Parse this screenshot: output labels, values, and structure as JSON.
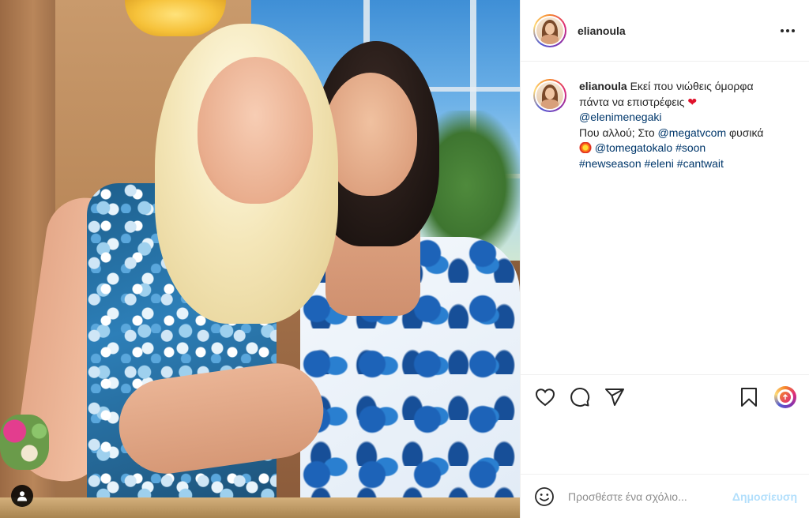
{
  "post": {
    "username": "elianoula",
    "caption": {
      "username": "elianoula",
      "line1": "Εκεί που νιώθεις όμορφα",
      "line2": "πάντα να επιστρέφεις",
      "mention1": "@elenimenegaki",
      "line3_prefix": "Που αλλού; Στο",
      "mention2": "@megatvcom",
      "line3_suffix": "φυσικά",
      "mention3": "@tomegatokalo",
      "hashtag1": "#soon",
      "hashtag2": "#newseason",
      "hashtag3": "#eleni",
      "hashtag4": "#cantwait"
    },
    "icons": {
      "heart": "heart-icon",
      "comment": "comment-icon",
      "share": "share-icon",
      "save": "bookmark-icon",
      "boost": "boost-icon",
      "emoji": "emoji-icon",
      "user_tag": "user-icon",
      "more": "more-horizontal-icon"
    },
    "comment": {
      "placeholder": "Προσθέστε ένα σχόλιο...",
      "post_label": "Δημοσίευση"
    }
  },
  "colors": {
    "link": "#00376b",
    "heart_emoji": "#e0112b",
    "post_button_disabled": "#b2dffc"
  }
}
